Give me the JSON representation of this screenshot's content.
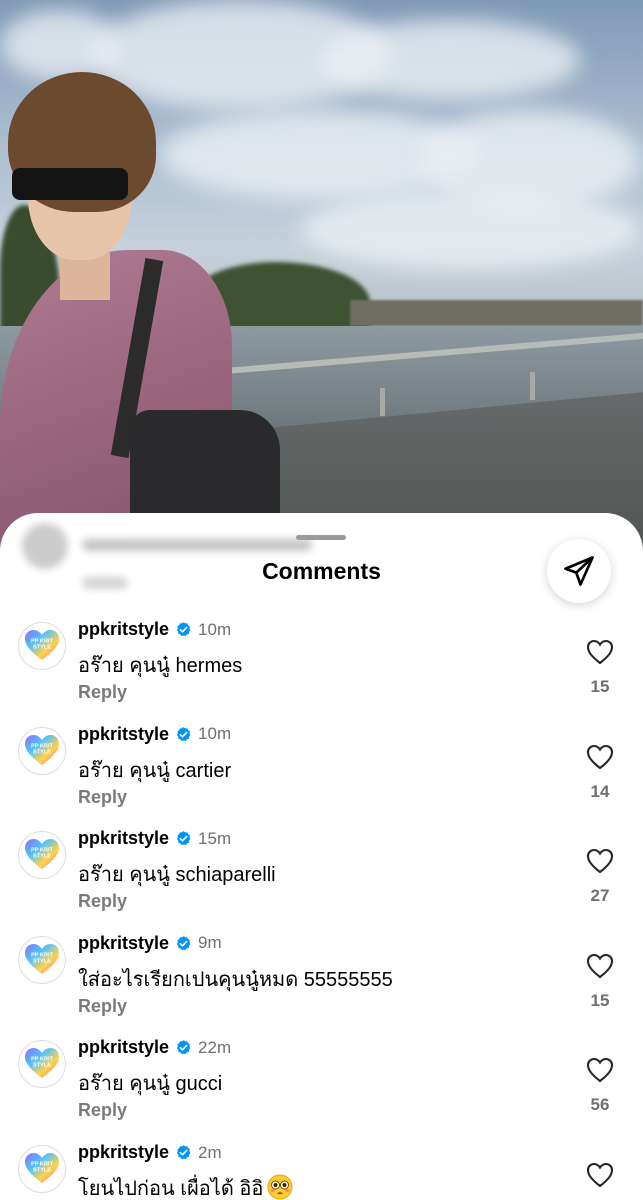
{
  "sheet": {
    "title": "Comments"
  },
  "comments": [
    {
      "username": "ppkritstyle",
      "time": "10m",
      "text": "อร๊าย คุนนู๋ hermes",
      "reply": "Reply",
      "likes": "15"
    },
    {
      "username": "ppkritstyle",
      "time": "10m",
      "text": "อร๊าย คุนนู๋ cartier",
      "reply": "Reply",
      "likes": "14"
    },
    {
      "username": "ppkritstyle",
      "time": "15m",
      "text": "อร๊าย คุนนู๋ schiaparelli",
      "reply": "Reply",
      "likes": "27"
    },
    {
      "username": "ppkritstyle",
      "time": "9m",
      "text": "ใส่อะไรเรียกเปนคุนนู๋หมด 55555555",
      "reply": "Reply",
      "likes": "15"
    },
    {
      "username": "ppkritstyle",
      "time": "22m",
      "text": "อร๊าย คุนนู๋ gucci",
      "reply": "Reply",
      "likes": "56"
    },
    {
      "username": "ppkritstyle",
      "time": "2m",
      "text": "โยนไปก่อน เผื่อได้ อิอิ",
      "emoji": "flushed-face",
      "reply": "",
      "likes": ""
    }
  ],
  "avatar_logo_text": "PP KRIT STYLE",
  "icons": {
    "verified": "verified-badge-icon",
    "heart": "heart-outline-icon",
    "send": "paper-plane-icon"
  },
  "colors": {
    "verified_blue": "#0095f6",
    "secondary_text": "#737373"
  }
}
